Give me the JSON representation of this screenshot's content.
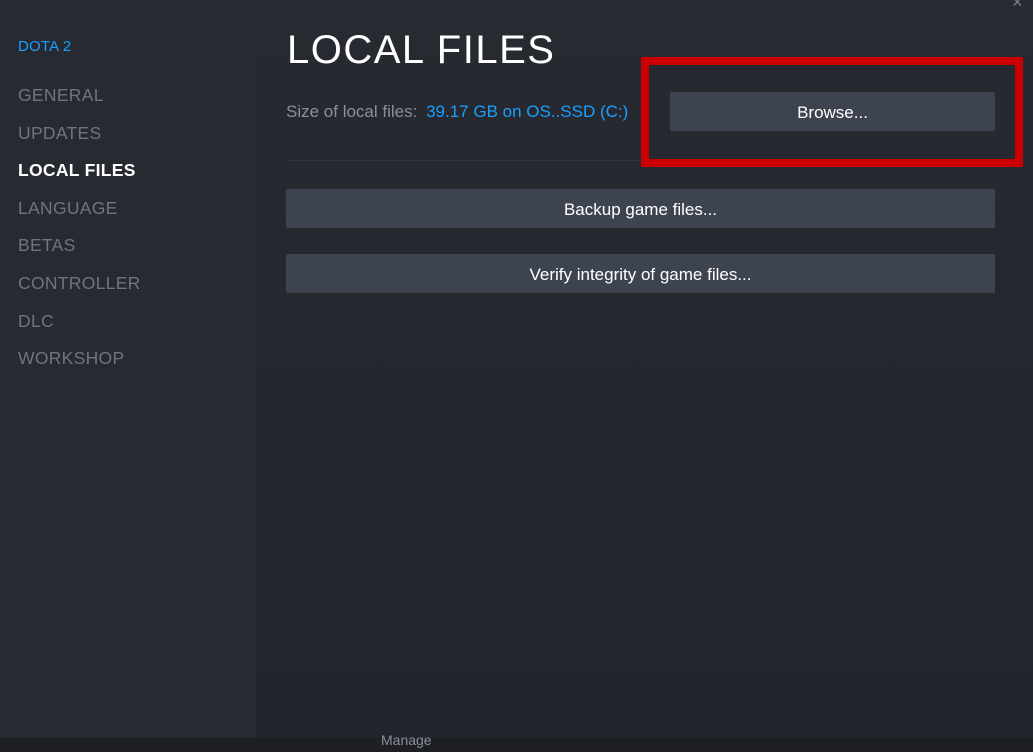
{
  "sidebar": {
    "game_title": "DOTA 2",
    "items": [
      {
        "label": "GENERAL",
        "active": false
      },
      {
        "label": "UPDATES",
        "active": false
      },
      {
        "label": "LOCAL FILES",
        "active": true
      },
      {
        "label": "LANGUAGE",
        "active": false
      },
      {
        "label": "BETAS",
        "active": false
      },
      {
        "label": "CONTROLLER",
        "active": false
      },
      {
        "label": "DLC",
        "active": false
      },
      {
        "label": "WORKSHOP",
        "active": false
      }
    ]
  },
  "main": {
    "title": "LOCAL FILES",
    "size_label": "Size of local files:",
    "size_value": "39.17 GB on OS..SSD (C:)",
    "browse_label": "Browse...",
    "backup_label": "Backup game files...",
    "verify_label": "Verify integrity of game files..."
  },
  "window": {
    "close_icon": "close-icon",
    "close_glyph": "×"
  },
  "bottom": {
    "label": "Manage"
  },
  "colors": {
    "accent": "#1a9fff",
    "highlight": "#cc0000",
    "button": "#3d4450",
    "background": "#22252c"
  }
}
